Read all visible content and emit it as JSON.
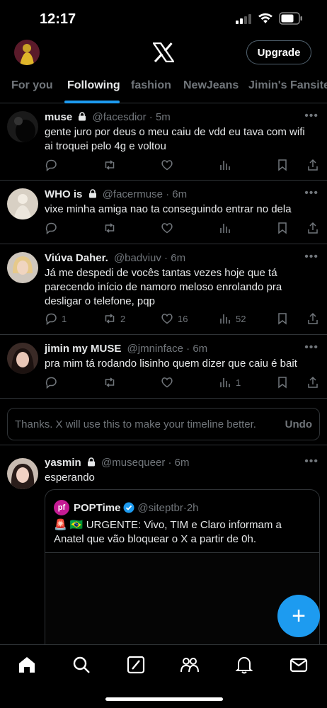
{
  "status_bar": {
    "time": "12:17"
  },
  "header": {
    "upgrade_label": "Upgrade"
  },
  "tabs": [
    "For you",
    "Following",
    "fashion",
    "NewJeans",
    "Jimin's Fansite"
  ],
  "posts": [
    {
      "name": "muse",
      "locked": true,
      "handle": "@facesdior",
      "time": "5m",
      "text": "gente juro por deus o meu caiu de vdd eu tava com wifi ai troquei pelo 4g e voltou",
      "replies": "",
      "reposts": "",
      "likes": "",
      "views": ""
    },
    {
      "name": "WHO is",
      "locked": true,
      "handle": "@facermuse",
      "time": "6m",
      "text": "vixe minha amiga nao ta conseguindo entrar no dela",
      "replies": "",
      "reposts": "",
      "likes": "",
      "views": ""
    },
    {
      "name": "Viúva Daher.",
      "locked": false,
      "handle": "@badviuv",
      "time": "6m",
      "text": "Já me despedi de vocês tantas vezes hoje que tá parecendo início de namoro meloso enrolando pra desligar o telefone, pqp",
      "replies": "1",
      "reposts": "2",
      "likes": "16",
      "views": "52"
    },
    {
      "name": "jimin my MUSE",
      "locked": false,
      "handle": "@jmninface",
      "time": "6m",
      "text": "pra mim tá rodando lisinho quem dizer que caiu é bait",
      "replies": "",
      "reposts": "",
      "likes": "",
      "views": "1"
    },
    {
      "name": "yasmin",
      "locked": true,
      "handle": "@musequeer",
      "time": "6m",
      "text": "esperando"
    }
  ],
  "feedback": {
    "message": "Thanks. X will use this to make your timeline better.",
    "undo": "Undo"
  },
  "quote": {
    "avatar_text": "pf",
    "name": "POPTime",
    "handle": "@siteptbr",
    "time": "2h",
    "text": "🚨 🇧🇷 URGENTE: Vivo, TIM e Claro informam a Anatel que vão bloquear o X a partir de 0h."
  },
  "fab_label": "+",
  "colors": {
    "accent": "#1d9bf0",
    "background": "#000000",
    "muted": "#71767b",
    "border": "#2f3336"
  },
  "icons": [
    "home-icon",
    "search-icon",
    "grok-icon",
    "communities-icon",
    "notifications-icon",
    "messages-icon"
  ]
}
